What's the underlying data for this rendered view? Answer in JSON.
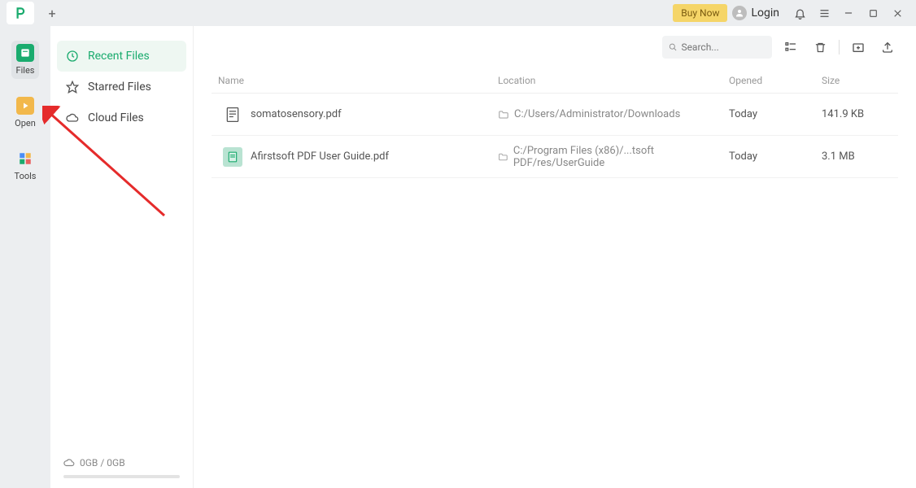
{
  "titlebar": {
    "buy_now": "Buy Now",
    "login": "Login"
  },
  "rail": {
    "files": "Files",
    "open": "Open",
    "tools": "Tools"
  },
  "sidepanel": {
    "recent": "Recent Files",
    "starred": "Starred Files",
    "cloud": "Cloud Files",
    "storage": "0GB / 0GB"
  },
  "toolbar": {
    "search_placeholder": "Search..."
  },
  "table": {
    "headers": {
      "name": "Name",
      "location": "Location",
      "opened": "Opened",
      "size": "Size"
    },
    "rows": [
      {
        "name": "somatosensory.pdf",
        "location": "C:/Users/Administrator/Downloads",
        "opened": "Today",
        "size": "141.9 KB",
        "icon": "pdf-doc"
      },
      {
        "name": "Afirstsoft PDF User Guide.pdf",
        "location": "C:/Program Files (x86)/...tsoft PDF/res/UserGuide",
        "opened": "Today",
        "size": "3.1 MB",
        "icon": "pdf-green"
      }
    ]
  }
}
